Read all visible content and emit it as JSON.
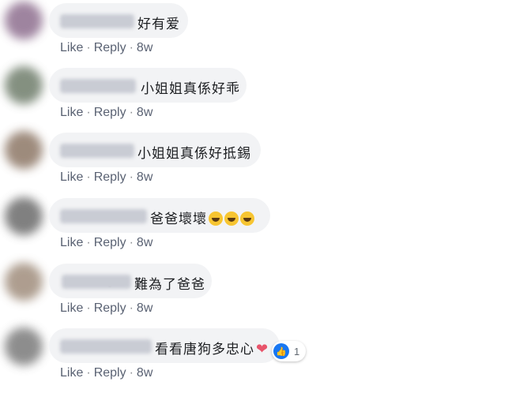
{
  "comments": [
    {
      "text": "好有爱",
      "actions": {
        "like": "Like",
        "reply": "Reply",
        "time": "8w"
      },
      "avatar_color": "#8e6f8f",
      "name_blur_color": "#c5c8d0"
    },
    {
      "text": "小姐姐真係好乖",
      "actions": {
        "like": "Like",
        "reply": "Reply",
        "time": "8w"
      },
      "avatar_color": "#6f7d6b",
      "name_blur_color": "#c5c8d0"
    },
    {
      "text": "小姐姐真係好抵錫",
      "actions": {
        "like": "Like",
        "reply": "Reply",
        "time": "8w"
      },
      "avatar_color": "#8d7766",
      "name_blur_color": "#c5c8d0"
    },
    {
      "text": "爸爸壞壞",
      "emoji": [
        "rolling-on-floor-laughing",
        "rolling-on-floor-laughing",
        "rolling-on-floor-laughing"
      ],
      "actions": {
        "like": "Like",
        "reply": "Reply",
        "time": "8w"
      },
      "avatar_color": "#6a6a6a",
      "name_blur_color": "#c5c8d0"
    },
    {
      "text": "難為了爸爸",
      "actions": {
        "like": "Like",
        "reply": "Reply",
        "time": "8w"
      },
      "avatar_color": "#a08d7c",
      "name_blur_color": "#c5c8d0"
    },
    {
      "text": "看看唐狗多忠心",
      "emoji": [
        "red-heart"
      ],
      "reaction": {
        "icon": "thumbs-up",
        "count": "1",
        "color": "#1877f2"
      },
      "actions": {
        "like": "Like",
        "reply": "Reply",
        "time": "8w"
      },
      "avatar_color": "#7a7a7a",
      "name_blur_color": "#c5c8d0"
    }
  ],
  "separator": "·"
}
